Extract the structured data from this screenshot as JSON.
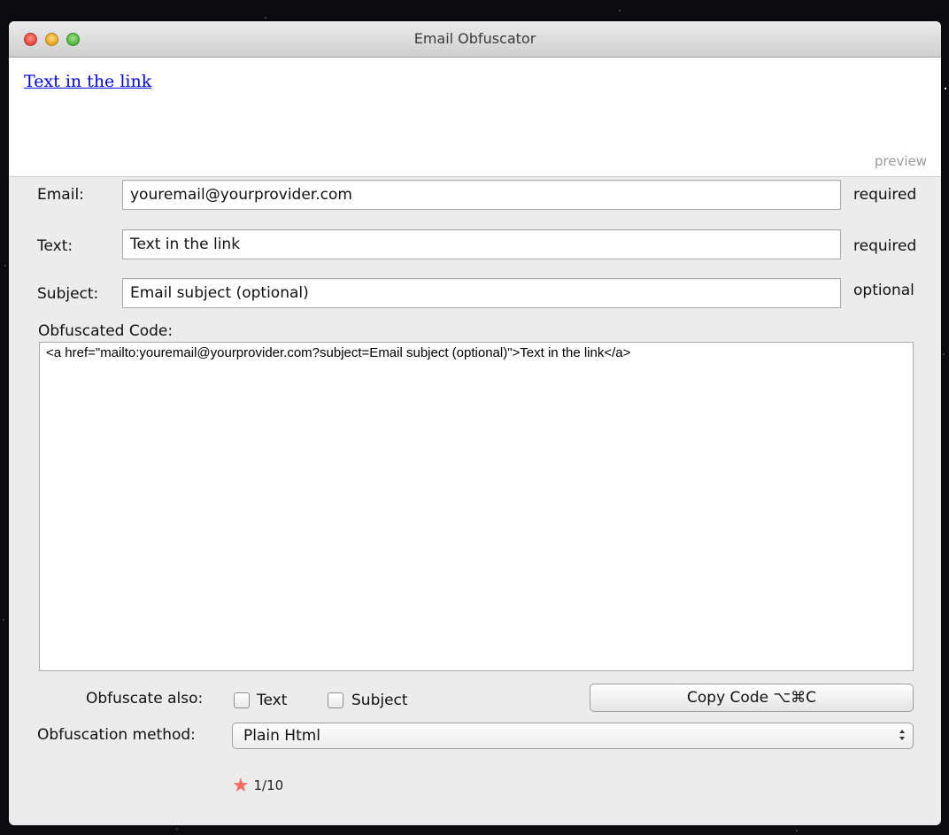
{
  "window": {
    "title": "Email Obfuscator"
  },
  "preview": {
    "link_text": "Text in the link",
    "label": "preview"
  },
  "form": {
    "email": {
      "label": "Email:",
      "value": "youremail@yourprovider.com",
      "hint": "required"
    },
    "text": {
      "label": "Text:",
      "value": "Text in the link",
      "hint": "required"
    },
    "subject": {
      "label": "Subject:",
      "value": "Email subject (optional)",
      "hint": "optional"
    }
  },
  "code": {
    "label": "Obfuscated Code:",
    "value": "<a href=\"mailto:youremail@yourprovider.com?subject=Email subject (optional)\">Text in the link</a>"
  },
  "obfuscate_also": {
    "label": "Obfuscate also:",
    "options": [
      {
        "label": "Text",
        "checked": false
      },
      {
        "label": "Subject",
        "checked": false
      }
    ]
  },
  "copy_button": {
    "label": "Copy Code  ⌥⌘C"
  },
  "method": {
    "label": "Obfuscation method:",
    "selected": "Plain Html"
  },
  "rating": {
    "icon": "star-icon",
    "text": "1/10",
    "color": "#f36b62"
  }
}
